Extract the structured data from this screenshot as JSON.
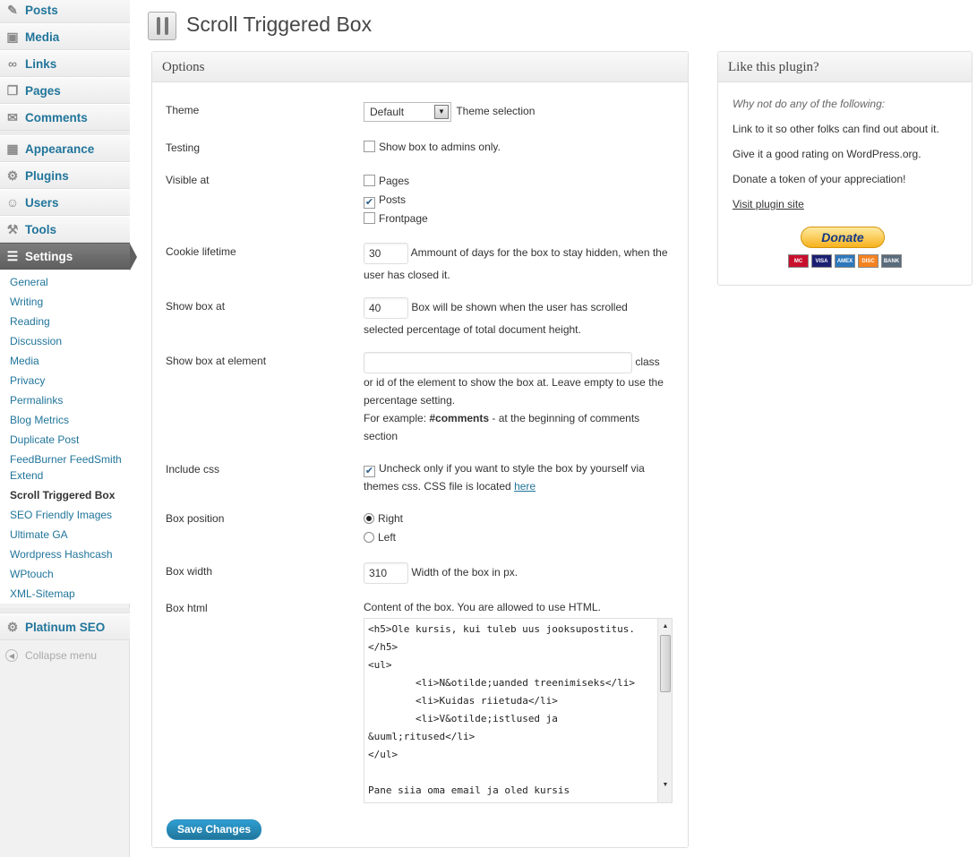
{
  "sidebar": {
    "menu": [
      {
        "label": "Posts",
        "icon": "pin-icon"
      },
      {
        "label": "Media",
        "icon": "media-icon"
      },
      {
        "label": "Links",
        "icon": "link-icon"
      },
      {
        "label": "Pages",
        "icon": "pages-icon"
      },
      {
        "label": "Comments",
        "icon": "comment-icon"
      },
      {
        "label": "Appearance",
        "icon": "appearance-icon"
      },
      {
        "label": "Plugins",
        "icon": "plugin-icon"
      },
      {
        "label": "Users",
        "icon": "users-icon"
      },
      {
        "label": "Tools",
        "icon": "tools-icon"
      },
      {
        "label": "Settings",
        "icon": "settings-icon"
      },
      {
        "label": "Platinum SEO",
        "icon": "seo-icon"
      }
    ],
    "submenu": [
      "General",
      "Writing",
      "Reading",
      "Discussion",
      "Media",
      "Privacy",
      "Permalinks",
      "Blog Metrics",
      "Duplicate Post",
      "FeedBurner FeedSmith Extend",
      "Scroll Triggered Box",
      "SEO Friendly Images",
      "Ultimate GA",
      "Wordpress Hashcash",
      "WPtouch",
      "XML-Sitemap"
    ],
    "collapse_label": "Collapse menu"
  },
  "header": {
    "title": "Scroll Triggered Box"
  },
  "options": {
    "heading": "Options",
    "theme": {
      "label": "Theme",
      "value": "Default",
      "note": "Theme selection"
    },
    "testing": {
      "label": "Testing",
      "option": "Show box to admins only.",
      "checked": false
    },
    "visible_at": {
      "label": "Visible at",
      "pages": "Pages",
      "posts": "Posts",
      "frontpage": "Frontpage"
    },
    "cookie": {
      "label": "Cookie lifetime",
      "value": "30",
      "note1": "Ammount of days for the box to stay hidden, when the",
      "note2": "user has closed it."
    },
    "show_at": {
      "label": "Show box at",
      "value": "40",
      "note1": "Box will be shown when the user has scrolled",
      "note2": "selected percentage of total document height."
    },
    "element": {
      "label": "Show box at element",
      "value": "",
      "suffix": "class",
      "line1": "or id of the element to show the box at. Leave empty to use the",
      "line2": "percentage setting.",
      "example_prefix": "For example: ",
      "example_code": "#comments",
      "example_rest": " - at the beginning of comments",
      "example_end": "section"
    },
    "include_css": {
      "label": "Include css",
      "line1": "Uncheck only if you want to style the box by yourself via",
      "line2": "themes css. CSS file is located ",
      "link": "here"
    },
    "position": {
      "label": "Box position",
      "right": "Right",
      "left": "Left",
      "selected": "Right"
    },
    "width": {
      "label": "Box width",
      "value": "310",
      "note": "Width of the box in px."
    },
    "html": {
      "label": "Box html",
      "note": "Content of the box. You are allowed to use HTML.",
      "content": "<h5>Ole kursis, kui tuleb uus jooksupostitus.</h5>\n<ul>\n        <li>N&otilde;uanded treenimiseks</li>\n        <li>Kuidas riietuda</li>\n        <li>V&otilde;istlused ja &uuml;ritused</li>\n</ul>\n\nPane siia oma email ja oled kursis"
    },
    "save_label": "Save Changes"
  },
  "like": {
    "heading": "Like this plugin?",
    "intro": "Why not do any of the following:",
    "item1": "Link to it so other folks can find out about it.",
    "item2": "Give it a good rating on WordPress.org.",
    "item3": "Donate a token of your appreciation!",
    "link": "Visit plugin site",
    "donate_label": "Donate",
    "cards": [
      "MC",
      "VISA",
      "AMEX",
      "DISC",
      "BANK"
    ]
  },
  "colors": {
    "link": "#21759b",
    "button": "#21759b",
    "current_menu": "#6d6d6d",
    "donate": "#f7b21e"
  }
}
